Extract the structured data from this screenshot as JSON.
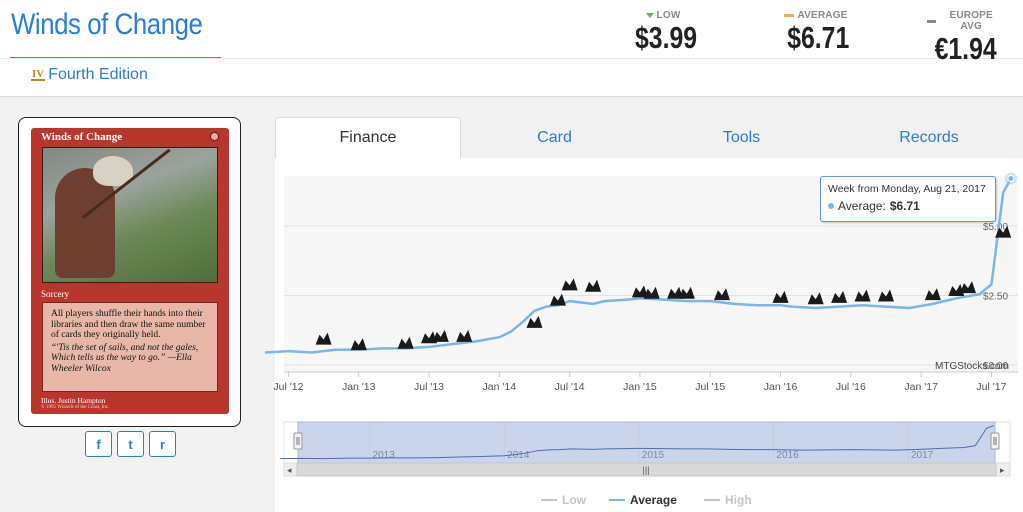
{
  "header": {
    "card_title": "Winds of Change",
    "set_icon": "IV",
    "set_name": "Fourth Edition",
    "prices": [
      {
        "label": "LOW",
        "value": "$3.99",
        "marker_color": "#5cb85c"
      },
      {
        "label": "AVERAGE",
        "value": "$6.71",
        "marker_color": "#f0ad4e"
      },
      {
        "label": "EUROPE AVG",
        "value": "€1.94",
        "marker_color": "#888888"
      }
    ]
  },
  "card_image": {
    "name": "Winds of Change",
    "type_line": "Sorcery",
    "rules_text": "All players shuffle their hands into their libraries and then draw the same number of cards they originally held.",
    "flavor_text": "“'Tis the set of sails, and not the gales, Which tells us the way to go.” —Ella Wheeler Wilcox",
    "illustrator": "Illus. Justin Hampton",
    "copyright": "© 1995 Wizards of the Coast, Inc."
  },
  "share": {
    "facebook": "f",
    "twitter": "t",
    "reddit": "r",
    "facebook_icon": "facebook-icon",
    "twitter_icon": "twitter-icon",
    "reddit_icon": "reddit-icon"
  },
  "tabs": [
    {
      "label": "Finance",
      "active": true
    },
    {
      "label": "Card",
      "active": false
    },
    {
      "label": "Tools",
      "active": false
    },
    {
      "label": "Records",
      "active": false
    }
  ],
  "chart_data": {
    "type": "line",
    "title": "",
    "xlabel": "",
    "ylabel": "",
    "x_ticks": [
      "Jul '12",
      "Jan '13",
      "Jul '13",
      "Jan '14",
      "Jul '14",
      "Jan '15",
      "Jul '15",
      "Jan '16",
      "Jul '16",
      "Jan '17",
      "Jul '17"
    ],
    "y_ticks": [
      "$0.00",
      "$2.50",
      "$5.00"
    ],
    "ylim": [
      0,
      6.8
    ],
    "credit": "MTGStocks.com",
    "series": [
      {
        "name": "Average",
        "color": "#7cb5ec",
        "points": [
          [
            "2012-05",
            0.45
          ],
          [
            "2012-07",
            0.5
          ],
          [
            "2012-09",
            0.45
          ],
          [
            "2012-11",
            0.55
          ],
          [
            "2013-01",
            0.55
          ],
          [
            "2013-03",
            0.6
          ],
          [
            "2013-05",
            0.6
          ],
          [
            "2013-07",
            0.65
          ],
          [
            "2013-09",
            0.75
          ],
          [
            "2013-11",
            0.85
          ],
          [
            "2014-01",
            1.0
          ],
          [
            "2014-02",
            1.2
          ],
          [
            "2014-03",
            1.55
          ],
          [
            "2014-04",
            1.95
          ],
          [
            "2014-05",
            2.1
          ],
          [
            "2014-06",
            2.15
          ],
          [
            "2014-07",
            2.3
          ],
          [
            "2014-08",
            2.25
          ],
          [
            "2014-09",
            2.2
          ],
          [
            "2014-10",
            2.3
          ],
          [
            "2014-12",
            2.35
          ],
          [
            "2015-01",
            2.4
          ],
          [
            "2015-03",
            2.35
          ],
          [
            "2015-05",
            2.3
          ],
          [
            "2015-07",
            2.3
          ],
          [
            "2015-09",
            2.2
          ],
          [
            "2015-11",
            2.15
          ],
          [
            "2016-01",
            2.15
          ],
          [
            "2016-02",
            2.1
          ],
          [
            "2016-04",
            2.05
          ],
          [
            "2016-06",
            2.1
          ],
          [
            "2016-08",
            2.15
          ],
          [
            "2016-10",
            2.1
          ],
          [
            "2016-12",
            2.05
          ],
          [
            "2017-02",
            2.2
          ],
          [
            "2017-04",
            2.4
          ],
          [
            "2017-06",
            2.55
          ],
          [
            "2017-07",
            2.9
          ],
          [
            "2017-08",
            6.2
          ],
          [
            "2017-08-21",
            6.71
          ]
        ]
      }
    ],
    "set_markers": [
      {
        "date": "2012-10",
        "y": 0.95
      },
      {
        "date": "2013-01",
        "y": 0.75
      },
      {
        "date": "2013-05",
        "y": 0.8
      },
      {
        "date": "2013-07",
        "y": 1.0
      },
      {
        "date": "2013-08",
        "y": 1.05
      },
      {
        "date": "2013-10",
        "y": 1.05
      },
      {
        "date": "2014-04",
        "y": 1.55
      },
      {
        "date": "2014-06",
        "y": 2.35
      },
      {
        "date": "2014-07",
        "y": 2.9
      },
      {
        "date": "2014-09",
        "y": 2.85
      },
      {
        "date": "2015-01",
        "y": 2.65
      },
      {
        "date": "2015-02",
        "y": 2.6
      },
      {
        "date": "2015-04",
        "y": 2.6
      },
      {
        "date": "2015-05",
        "y": 2.6
      },
      {
        "date": "2015-08",
        "y": 2.55
      },
      {
        "date": "2016-01",
        "y": 2.45
      },
      {
        "date": "2016-04",
        "y": 2.4
      },
      {
        "date": "2016-06",
        "y": 2.45
      },
      {
        "date": "2016-08",
        "y": 2.5
      },
      {
        "date": "2016-10",
        "y": 2.5
      },
      {
        "date": "2017-02",
        "y": 2.55
      },
      {
        "date": "2017-04",
        "y": 2.7
      },
      {
        "date": "2017-05",
        "y": 2.8
      },
      {
        "date": "2017-08",
        "y": 4.8
      }
    ],
    "tooltip": {
      "header": "Week from Monday, Aug 21, 2017",
      "series_label": "Average:",
      "value": "$6.71"
    },
    "navigator": {
      "year_labels": [
        "2013",
        "2014",
        "2015",
        "2016",
        "2017"
      ],
      "scrollbar_grip": "|||"
    },
    "legend": [
      {
        "name": "Low",
        "color": "#c4c4c4",
        "enabled": false
      },
      {
        "name": "Average",
        "color": "#7cb5ec",
        "enabled": true
      },
      {
        "name": "High",
        "color": "#c4c4c4",
        "enabled": false
      }
    ]
  }
}
